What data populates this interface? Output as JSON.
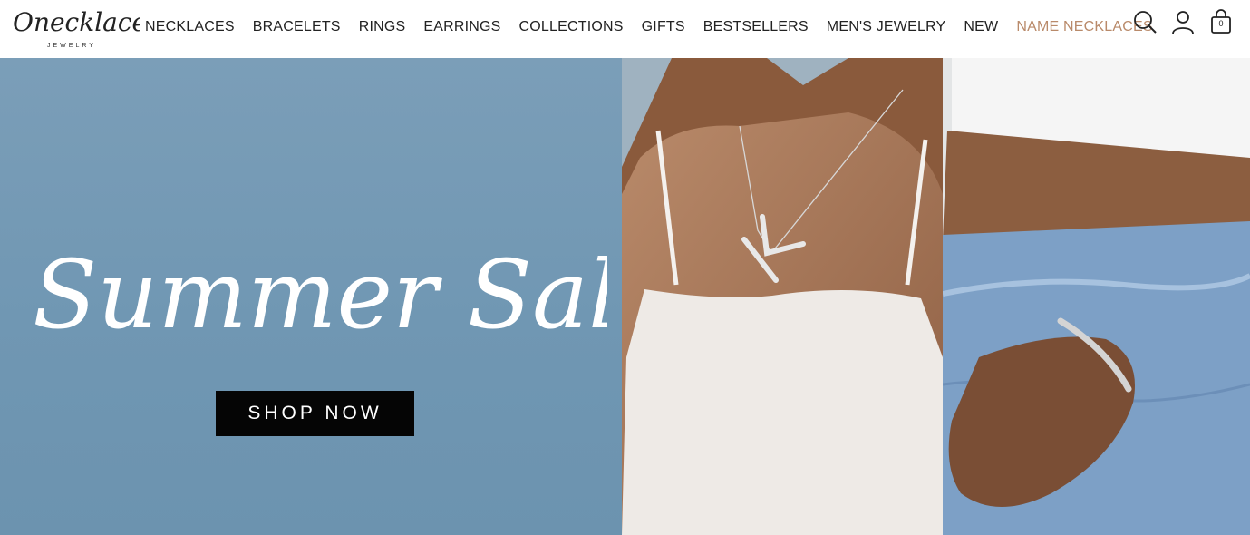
{
  "brand": {
    "logo_text": "Onecklace",
    "logo_subtext": "JEWELRY"
  },
  "nav": {
    "items": [
      {
        "label": "NECKLACES"
      },
      {
        "label": "BRACELETS"
      },
      {
        "label": "RINGS"
      },
      {
        "label": "EARRINGS"
      },
      {
        "label": "COLLECTIONS"
      },
      {
        "label": "GIFTS"
      },
      {
        "label": "BESTSELLERS"
      },
      {
        "label": "MEN'S JEWELRY"
      },
      {
        "label": "NEW"
      },
      {
        "label": "NAME NECKLACES"
      }
    ],
    "accent_color": "#b98a6a"
  },
  "header_icons": {
    "search": "search-icon",
    "account": "user-icon",
    "cart": "shopping-bag-icon",
    "cart_count": "0"
  },
  "hero": {
    "title": "Summer Sale",
    "button_label": "SHOP NOW",
    "panel_color": "#7097b3",
    "button_color": "#050505",
    "photos": [
      {
        "name": "model-initial-necklace-photo"
      },
      {
        "name": "model-name-bracelet-photo"
      }
    ]
  }
}
